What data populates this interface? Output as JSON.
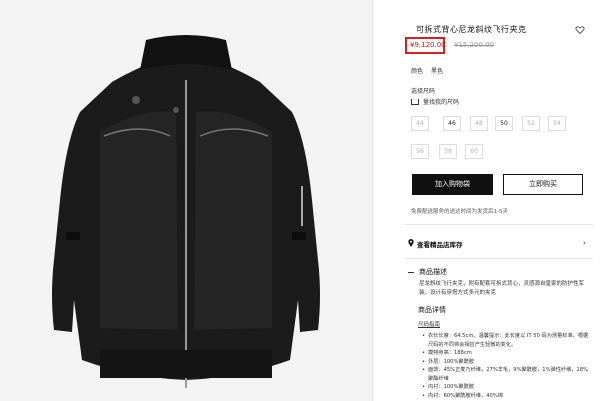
{
  "product": {
    "title": "可拆式背心尼龙斜纹飞行夹克",
    "price": "¥9,120.00",
    "old_price": "¥15,200.00",
    "color_label": "颜色",
    "color_value": "黑色",
    "size_label": "选择尺码",
    "size_guide": "量找我的尺码",
    "sizes": [
      {
        "label": "44",
        "available": false
      },
      {
        "label": "46",
        "available": true
      },
      {
        "label": "48",
        "available": false
      },
      {
        "label": "50",
        "available": true
      },
      {
        "label": "52",
        "available": false
      },
      {
        "label": "54",
        "available": false
      },
      {
        "label": "56",
        "available": false
      },
      {
        "label": "58",
        "available": false
      },
      {
        "label": "60",
        "available": false
      }
    ],
    "add_to_cart": "加入购物袋",
    "buy_now": "立即购买",
    "shipping_note": "免费配送服务的送达时间为发货后1-5天"
  },
  "store": {
    "label": "查看精品店库存",
    "chevron": "›"
  },
  "description": {
    "heading": "商品描述",
    "text": "尼龙斜纹飞行夹克，附有配套可拆式背心，灵感源自皇家的防护性军装，设计有穿搭方式多元的夹克"
  },
  "details": {
    "heading": "商品详情",
    "fit_link": "尺码指南",
    "bullets": [
      "衣长长度：64.5cm。温馨提示：此长度以 IT 50 码为测量标准，根据尺码的不同将会相应产生轻微的变化。",
      "模特身高：188cm",
      "外层：100%聚酰胺",
      "面饰：45%正麦乃纤维，27%羊毛，9%聚酰胺，1%弹性纤维，18%聚酯纤维",
      "内衬：100%聚酰胺",
      "内衬：60%聚酰胺纤维，40%棉"
    ]
  },
  "colors": {
    "price_highlight": "#d62020",
    "button_dark": "#111111"
  }
}
